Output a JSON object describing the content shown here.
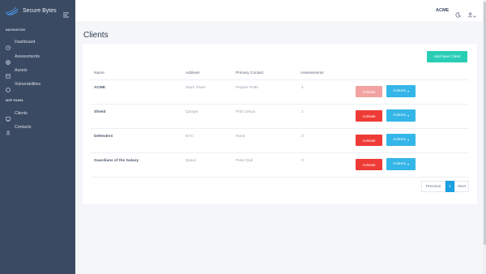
{
  "brand": {
    "name": "Secure Bytes",
    "logo_icon": "wave-logo-icon",
    "toggle_icon": "menu-collapse-icon"
  },
  "sidebar": {
    "sections": [
      {
        "heading": "NAVIGATION",
        "items": [
          {
            "label": "Dashboard",
            "icon": "clock-icon"
          },
          {
            "label": "Assessments",
            "icon": "globe-icon"
          },
          {
            "label": "Assets",
            "icon": "box-icon"
          },
          {
            "label": "Vulnerabilities",
            "icon": "circle-icon"
          }
        ]
      },
      {
        "heading": "MSP PANEL",
        "items": [
          {
            "label": "Clients",
            "icon": "monitor-icon"
          },
          {
            "label": "Contacts",
            "icon": "user-icon"
          }
        ]
      }
    ]
  },
  "header": {
    "org": "ACME",
    "theme_icon": "moon-icon",
    "user_icon": "user-icon"
  },
  "page": {
    "title": "Clients"
  },
  "toolbar": {
    "add_label": "Add New Client"
  },
  "table": {
    "columns": [
      "Name",
      "Address",
      "Primary Contact",
      "Assessments"
    ],
    "rows": [
      {
        "name": "ACME",
        "address": "Stark Tower",
        "contact": "Pepper Potts",
        "assessments": "4",
        "activate": "Activate",
        "actions": "Actions",
        "activate_disabled": true
      },
      {
        "name": "Shield",
        "address": "Quinjet",
        "contact": "Phil Colson",
        "assessments": "1",
        "activate": "Activate",
        "actions": "Actions",
        "activate_disabled": false
      },
      {
        "name": "Defenders",
        "address": "NYC",
        "contact": "None",
        "assessments": "0",
        "activate": "Activate",
        "actions": "Actions",
        "activate_disabled": false
      },
      {
        "name": "Guardians of the Galaxy",
        "address": "Space",
        "contact": "Peter Quil",
        "assessments": "0",
        "activate": "Activate",
        "actions": "Actions",
        "activate_disabled": false
      }
    ]
  },
  "pagination": {
    "previous": "Previous",
    "current": "1",
    "next": "Next"
  },
  "colors": {
    "sidebar": "#3b4a63",
    "accent_teal": "#28cdb4",
    "danger": "#ef3b36",
    "info": "#35b6e8",
    "primary": "#1aa0e0"
  }
}
